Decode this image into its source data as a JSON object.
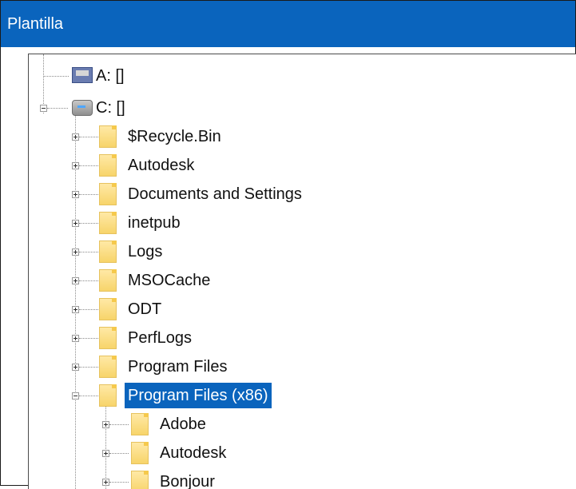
{
  "window": {
    "title": "Plantilla"
  },
  "tree": {
    "drives": [
      {
        "label": "A: []",
        "icon": "floppy-drive-icon",
        "expanded": false
      },
      {
        "label": "C: []",
        "icon": "hard-drive-icon",
        "expanded": true
      }
    ],
    "c_children": [
      {
        "label": "$Recycle.Bin"
      },
      {
        "label": "Autodesk"
      },
      {
        "label": "Documents and Settings"
      },
      {
        "label": "inetpub"
      },
      {
        "label": "Logs"
      },
      {
        "label": "MSOCache"
      },
      {
        "label": "ODT"
      },
      {
        "label": "PerfLogs"
      },
      {
        "label": "Program Files"
      },
      {
        "label": "Program Files (x86)",
        "selected": true,
        "expanded": true
      }
    ],
    "x86_children": [
      {
        "label": "Adobe"
      },
      {
        "label": "Autodesk"
      },
      {
        "label": "Bonjour"
      }
    ]
  },
  "colors": {
    "titlebar": "#0a64bd",
    "selection": "#0a64bd",
    "folder": "#f7d46a"
  }
}
